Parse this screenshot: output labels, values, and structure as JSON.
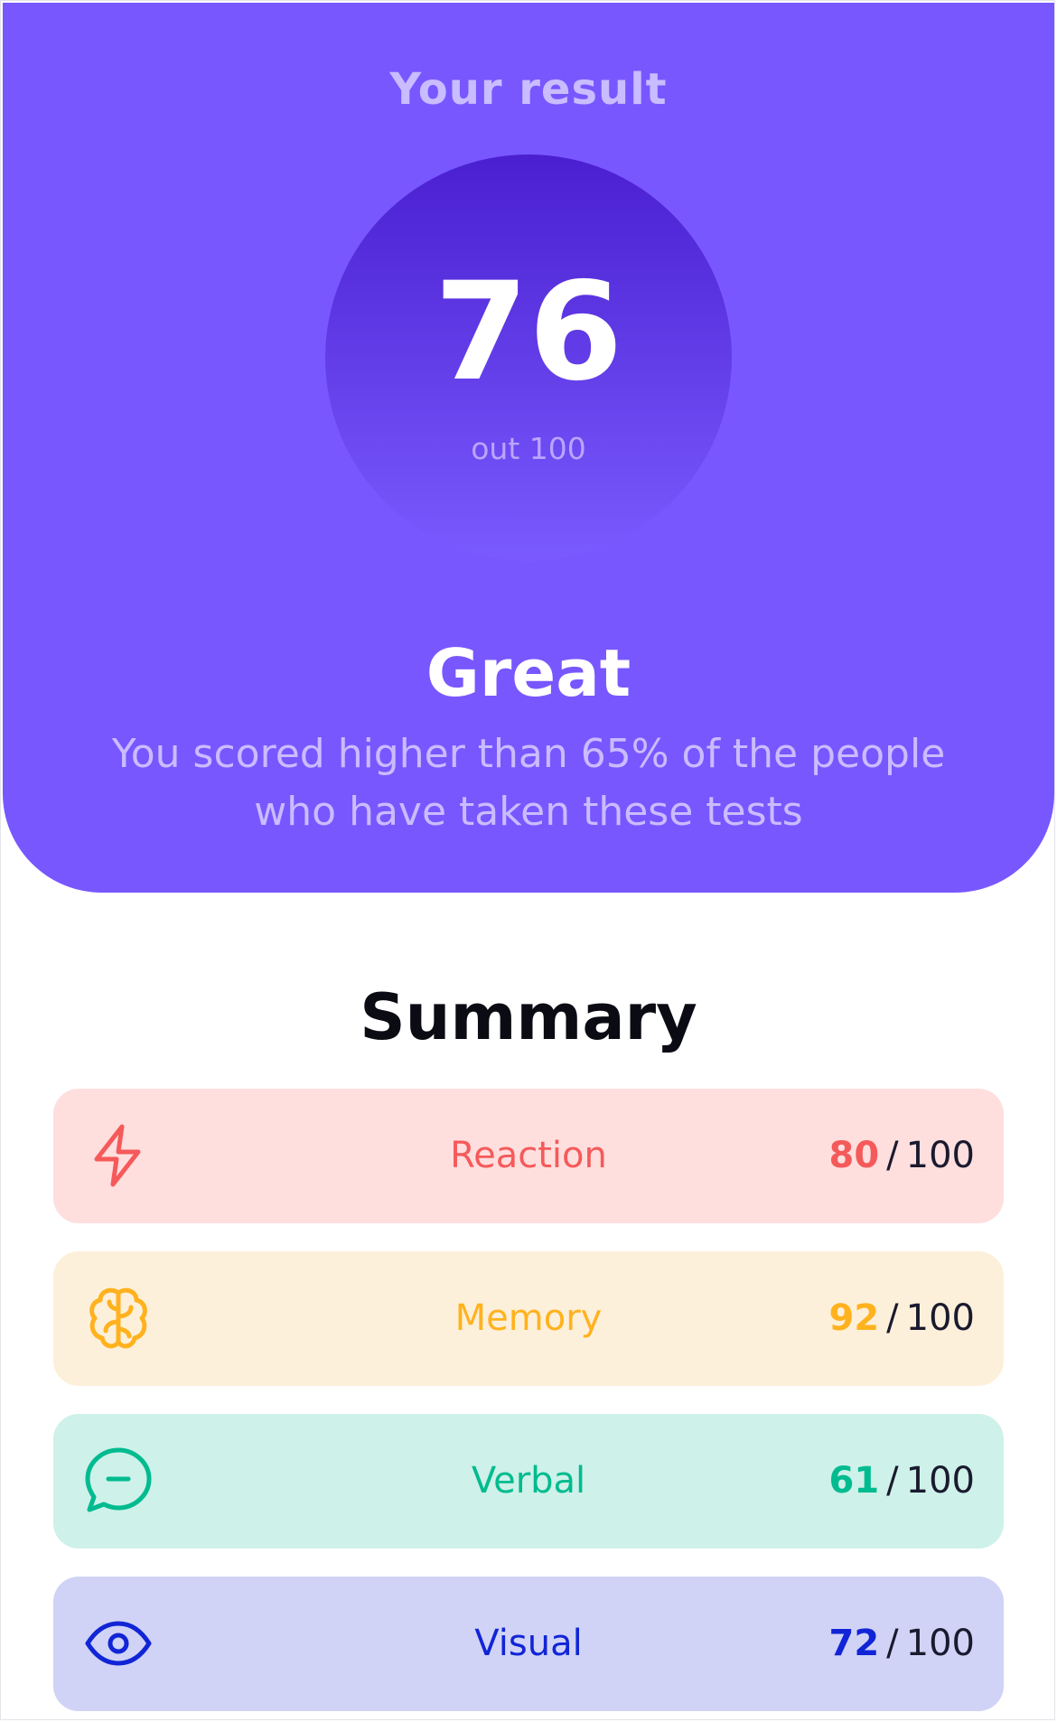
{
  "hero": {
    "label": "Your result",
    "score": "76",
    "out_of": "out 100",
    "rating": "Great",
    "description": "You scored higher than 65% of the people who have taken these tests"
  },
  "summary": {
    "title": "Summary",
    "items": [
      {
        "label": "Reaction",
        "score": "80",
        "separator": "/",
        "max": "100",
        "icon": "lightning-icon",
        "color": "#f55a5a",
        "bg": "#ffdede"
      },
      {
        "label": "Memory",
        "score": "92",
        "separator": "/",
        "max": "100",
        "icon": "brain-icon",
        "color": "#ffb21e",
        "bg": "#fdf0da"
      },
      {
        "label": "Verbal",
        "score": "61",
        "separator": "/",
        "max": "100",
        "icon": "chat-bubble-icon",
        "color": "#00bb8f",
        "bg": "#cef1e9"
      },
      {
        "label": "Visual",
        "score": "72",
        "separator": "/",
        "max": "100",
        "icon": "eye-icon",
        "color": "#1125d6",
        "bg": "#d0d3f6"
      }
    ]
  },
  "colors": {
    "hero_bg": "#7857ff",
    "circle_top": "#4a1fd0",
    "circle_bottom": "#7a5bff"
  }
}
